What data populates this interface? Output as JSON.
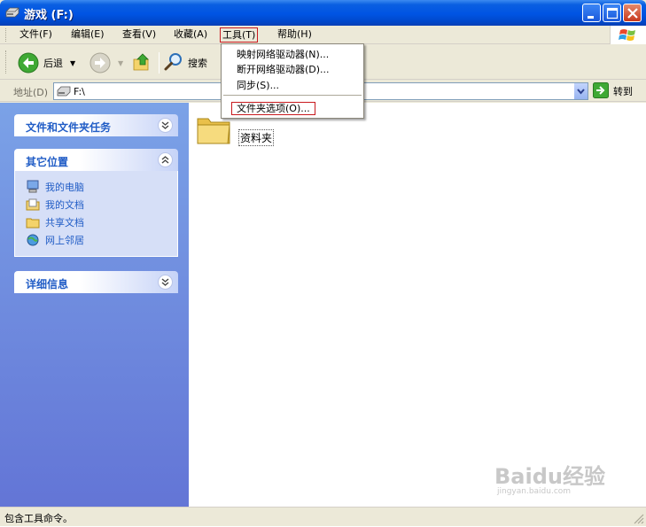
{
  "window": {
    "title": "游戏 (F:)",
    "controls": [
      "minimize",
      "maximize",
      "close"
    ]
  },
  "menubar": {
    "items": [
      {
        "label": "文件(F)"
      },
      {
        "label": "编辑(E)"
      },
      {
        "label": "查看(V)"
      },
      {
        "label": "收藏(A)"
      },
      {
        "label": "工具(T)",
        "active": true
      },
      {
        "label": "帮助(H)"
      }
    ]
  },
  "toolbar": {
    "back_label": "后退",
    "search_label": "搜索"
  },
  "address": {
    "label": "地址(D)",
    "value": "F:\\",
    "go_label": "转到"
  },
  "tools_menu": {
    "items": [
      {
        "label": "映射网络驱动器(N)..."
      },
      {
        "label": "断开网络驱动器(D)..."
      },
      {
        "label": "同步(S)..."
      },
      {
        "label": "文件夹选项(O)...",
        "highlighted": true
      }
    ]
  },
  "left_panel": {
    "tasks": {
      "title": "文件和文件夹任务"
    },
    "other_places": {
      "title": "其它位置",
      "links": [
        {
          "label": "我的电脑",
          "icon": "my-computer-icon"
        },
        {
          "label": "我的文档",
          "icon": "my-documents-icon"
        },
        {
          "label": "共享文档",
          "icon": "shared-folder-icon"
        },
        {
          "label": "网上邻居",
          "icon": "network-places-icon"
        }
      ]
    },
    "details": {
      "title": "详细信息"
    }
  },
  "content": {
    "items": [
      {
        "name": "资料夹",
        "type": "folder"
      }
    ]
  },
  "statusbar": {
    "text": "包含工具命令。"
  },
  "watermark": {
    "brand": "Baidu经验",
    "url": "jingyan.baidu.com"
  },
  "colors": {
    "title_blue": "#0054e3",
    "panel_blue": "#6375d6",
    "link_blue": "#215dc6",
    "highlight_red": "#c8191e"
  }
}
